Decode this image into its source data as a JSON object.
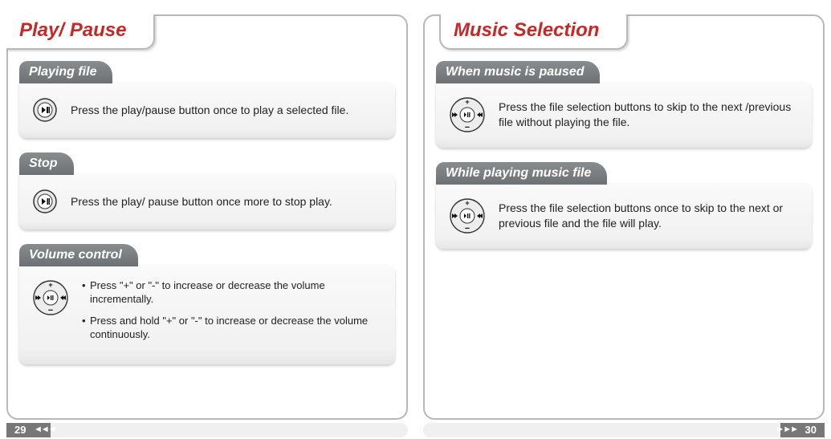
{
  "left": {
    "tab_title": "Play/ Pause",
    "page_number": "29",
    "arrows": "◄◄◄",
    "sections": [
      {
        "header": "Playing file",
        "text": "Press the play/pause button once to play a selected file.",
        "icon": "playpause"
      },
      {
        "header": "Stop",
        "text": "Press the play/ pause button once more to stop play.",
        "icon": "playpause"
      },
      {
        "header": "Volume control",
        "bullets": [
          "Press \"+\" or \"-\" to increase or decrease the volume incrementally.",
          "Press and hold \"+\" or \"-\" to increase or decrease the volume continuously."
        ],
        "icon": "dpad"
      }
    ]
  },
  "right": {
    "tab_title": "Music Selection",
    "page_number": "30",
    "arrows": "►►►",
    "sections": [
      {
        "header": "When music is paused",
        "text": "Press the file selection buttons to skip to the next /previous file without playing the file.",
        "icon": "dpad"
      },
      {
        "header": "While playing music file",
        "text": "Press the file selection buttons once to skip to the next or previous file and the file will play.",
        "icon": "dpad"
      }
    ]
  }
}
